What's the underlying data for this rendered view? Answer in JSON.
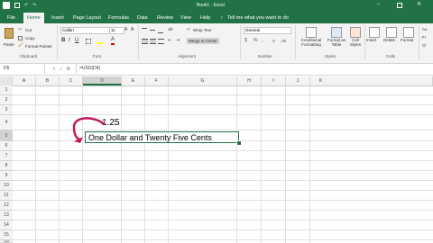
{
  "window": {
    "title": "Book1 - Excel"
  },
  "ribbon_tabs": [
    "File",
    "Home",
    "Insert",
    "Page Layout",
    "Formulas",
    "Data",
    "Review",
    "View",
    "Help"
  ],
  "tell_me": "Tell me what you want to do",
  "clipboard": {
    "cut": "Cut",
    "copy": "Copy",
    "format_painter": "Format Painter",
    "paste": "Paste",
    "group_label": "Clipboard"
  },
  "font": {
    "name": "Calibri",
    "size": "11",
    "group_label": "Font"
  },
  "alignment": {
    "wrap_text": "Wrap Text",
    "merge_center": "Merge & Center",
    "group_label": "Alignment"
  },
  "number": {
    "format": "General",
    "group_label": "Number"
  },
  "styles": {
    "conditional": "Conditional Formatting",
    "format_table": "Format as Table",
    "cell_styles": "Cell Styles",
    "group_label": "Styles"
  },
  "cells": {
    "insert": "Insert",
    "delete": "Delete",
    "format": "Format",
    "group_label": "Cells"
  },
  "editing": {
    "autosum": "Au",
    "fill": "Fi",
    "clear": "Cl"
  },
  "formula_bar": {
    "name_box": "D5",
    "fx": "fx",
    "formula": "=USD(D4)"
  },
  "columns": [
    "A",
    "B",
    "C",
    "D",
    "E",
    "F",
    "G",
    "H",
    "I",
    "J",
    "K"
  ],
  "rows": [
    "1",
    "2",
    "3",
    "4",
    "5",
    "6",
    "7",
    "8",
    "9",
    "10",
    "11",
    "12",
    "13",
    "14",
    "15",
    "16"
  ],
  "cells_data": {
    "d4": "1.25",
    "d5": "One Dollar and Twenty Five Cents"
  },
  "colors": {
    "excel_green": "#217346",
    "arrow": "#c2185b"
  }
}
